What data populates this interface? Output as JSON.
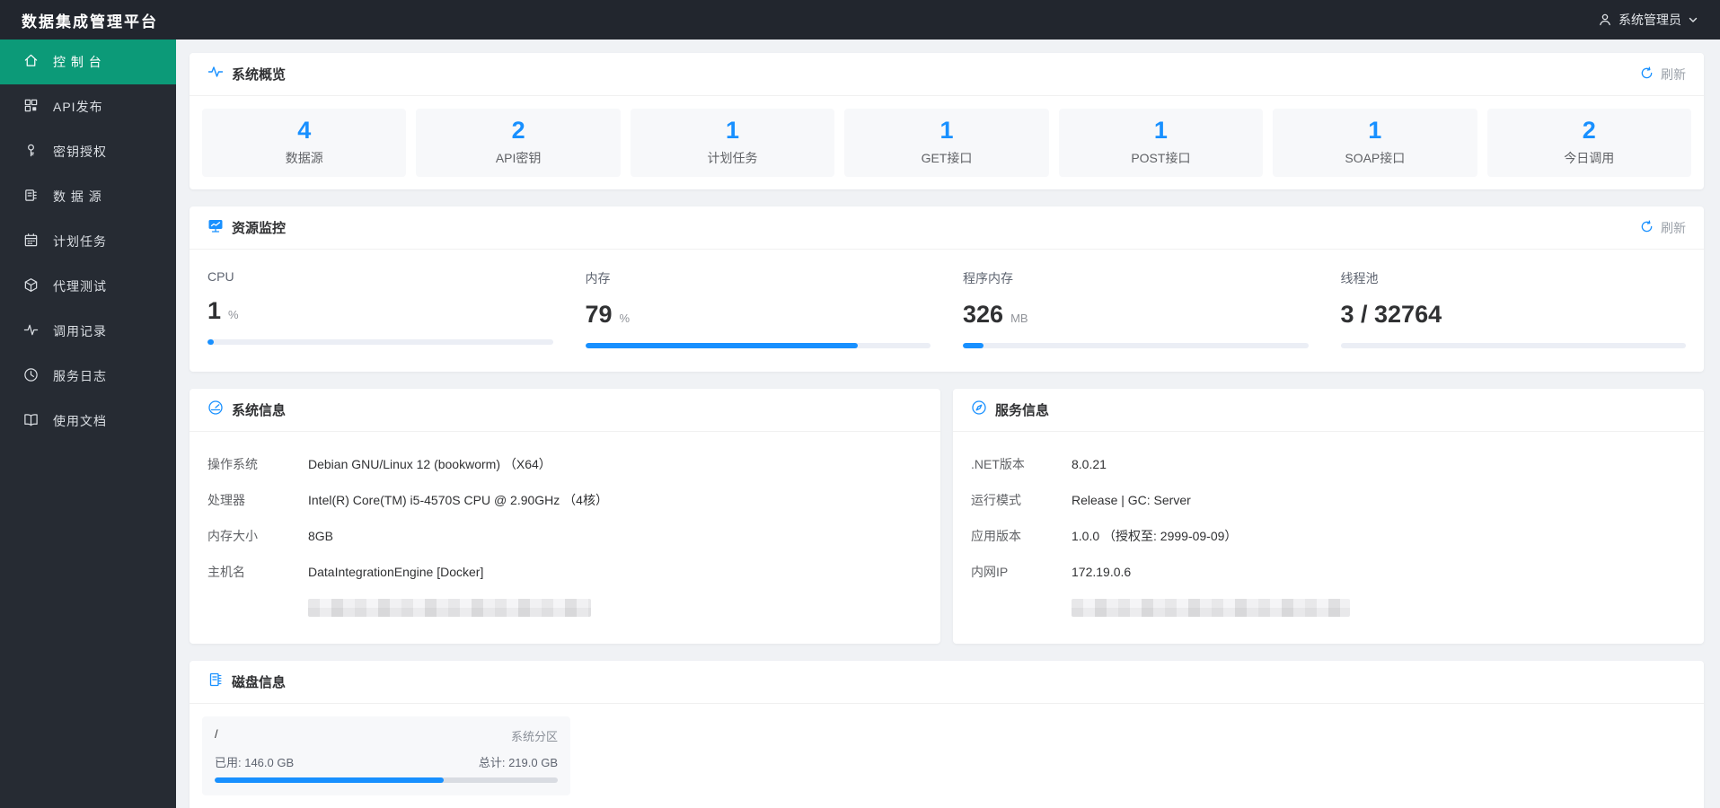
{
  "colors": {
    "accent": "#1890ff",
    "active_teal": "#0c9a78",
    "dark_bar": "#22262e",
    "sidebar_bg": "#262b33",
    "page_bg": "#f0f2f5"
  },
  "topbar": {
    "title": "数据集成管理平台",
    "user_name": "系统管理员",
    "user_icon": "person-icon",
    "chevron": "chevron-down-icon"
  },
  "sidebar": {
    "items": [
      {
        "label": "控 制 台",
        "icon": "home-icon",
        "active": true
      },
      {
        "label": "API发布",
        "icon": "api-grid-icon",
        "active": false
      },
      {
        "label": "密钥授权",
        "icon": "key-icon",
        "active": false
      },
      {
        "label": "数 据 源",
        "icon": "database-icon",
        "active": false
      },
      {
        "label": "计划任务",
        "icon": "calendar-icon",
        "active": false
      },
      {
        "label": "代理测试",
        "icon": "cube-icon",
        "active": false
      },
      {
        "label": "调用记录",
        "icon": "pulse-icon",
        "active": false
      },
      {
        "label": "服务日志",
        "icon": "clock-icon",
        "active": false
      },
      {
        "label": "使用文档",
        "icon": "book-icon",
        "active": false
      }
    ]
  },
  "overview": {
    "title": "系统概览",
    "icon": "activity-icon",
    "refresh_label": "刷新",
    "stats": [
      {
        "value": "4",
        "label": "数据源"
      },
      {
        "value": "2",
        "label": "API密钥"
      },
      {
        "value": "1",
        "label": "计划任务"
      },
      {
        "value": "1",
        "label": "GET接口"
      },
      {
        "value": "1",
        "label": "POST接口"
      },
      {
        "value": "1",
        "label": "SOAP接口"
      },
      {
        "value": "2",
        "label": "今日调用"
      }
    ]
  },
  "resources": {
    "title": "资源监控",
    "icon": "monitor-chart-icon",
    "refresh_label": "刷新",
    "metrics": [
      {
        "label": "CPU",
        "value": "1",
        "unit": "%",
        "percent": 1.5
      },
      {
        "label": "内存",
        "value": "79",
        "unit": "%",
        "percent": 79
      },
      {
        "label": "程序内存",
        "value": "326",
        "unit": "MB",
        "percent": 6
      },
      {
        "label": "线程池",
        "value": "3 / 32764",
        "unit": "",
        "percent": 0
      }
    ]
  },
  "system_info": {
    "title": "系统信息",
    "icon": "gauge-icon",
    "rows": [
      {
        "label": "操作系统",
        "value": "Debian GNU/Linux 12 (bookworm)  （X64）"
      },
      {
        "label": "处理器",
        "value": "Intel(R) Core(TM) i5-4570S CPU @ 2.90GHz  （4核）"
      },
      {
        "label": "内存大小",
        "value": "8GB"
      },
      {
        "label": "主机名",
        "value": "DataIntegrationEngine [Docker]"
      }
    ],
    "redacted_row": true
  },
  "service_info": {
    "title": "服务信息",
    "icon": "compass-icon",
    "rows": [
      {
        "label": ".NET版本",
        "value": "8.0.21"
      },
      {
        "label": "运行模式",
        "value": "Release | GC: Server"
      },
      {
        "label": "应用版本",
        "value": "1.0.0 （授权至: 2999-09-09）"
      },
      {
        "label": "内网IP",
        "value": "172.19.0.6"
      }
    ],
    "redacted_row": true
  },
  "disk": {
    "title": "磁盘信息",
    "icon": "disk-icon",
    "partitions": [
      {
        "mount": "/",
        "name": "系统分区",
        "used": "已用: 146.0 GB",
        "total": "总计: 219.0 GB",
        "percent": 66.7
      }
    ]
  }
}
